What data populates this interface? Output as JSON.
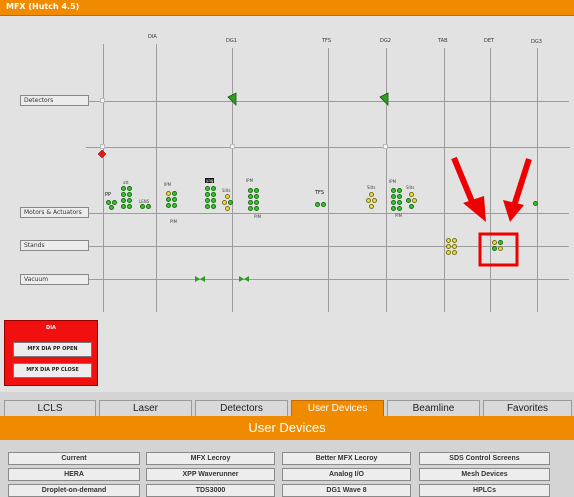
{
  "window": {
    "title": "MFX (Hutch 4.5)"
  },
  "synoptic": {
    "columns": [
      "DIA",
      "DG1",
      "TFS",
      "DG2",
      "TAB",
      "DET",
      "DG3"
    ],
    "rows": [
      "Detectors",
      "Motors & Actuators",
      "Stands",
      "Vacuum"
    ],
    "device_labels": {
      "pp": "PP",
      "att": "att",
      "lens": "LENS",
      "ipm1": "IPM",
      "pim1": "PIM",
      "yag": "yag",
      "slits1": "Slits",
      "ipm2": "IPM",
      "pim2": "PIM",
      "tfs": "TFS",
      "slits2": "Slits",
      "ipm3": "IPM",
      "slits3": "Slits",
      "pim3": "PIM"
    }
  },
  "red_panel": {
    "title": "DIA",
    "buttons": [
      "MFX DIA PP OPEN",
      "MFX DIA PP CLOSE"
    ]
  },
  "tabs": [
    {
      "label": "LCLS",
      "active": false
    },
    {
      "label": "Laser",
      "active": false
    },
    {
      "label": "Detectors",
      "active": false
    },
    {
      "label": "User Devices",
      "active": true
    },
    {
      "label": "Beamline",
      "active": false
    },
    {
      "label": "Favorites",
      "active": false
    }
  ],
  "section_title": "User Devices",
  "device_buttons": [
    [
      "Current",
      "MFX Lecroy",
      "Better MFX Lecroy",
      "SDS Control Screens"
    ],
    [
      "HERA",
      "XPP Waverunner",
      "Analog I/O",
      "Mesh Devices"
    ],
    [
      "Droplet-on-demand",
      "TDS3000",
      "DG1 Wave 8",
      "HPLCs"
    ]
  ],
  "colors": {
    "accent": "#f08a00",
    "alert_red": "#f01010",
    "status_green": "#32c832",
    "status_yellow": "#e8e04a"
  }
}
